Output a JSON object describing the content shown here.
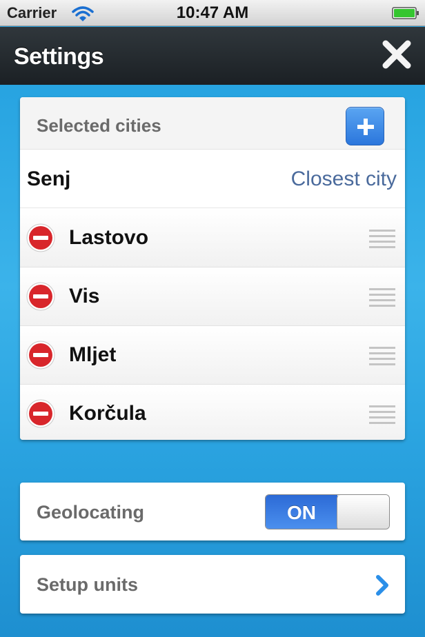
{
  "status_bar": {
    "carrier": "Carrier",
    "time": "10:47 AM",
    "icons": [
      "wifi-icon",
      "battery-icon"
    ]
  },
  "header": {
    "title": "Settings",
    "close_icon": "close-icon"
  },
  "cities": {
    "header_label": "Selected cities",
    "add_icon": "plus-icon",
    "closest": {
      "name": "Senj",
      "label": "Closest city"
    },
    "items": [
      {
        "name": "Lastovo"
      },
      {
        "name": "Vis"
      },
      {
        "name": "Mljet"
      },
      {
        "name": "Korčula"
      }
    ]
  },
  "geolocating": {
    "label": "Geolocating",
    "toggle_label": "ON",
    "toggle_state": true
  },
  "setup_units": {
    "label": "Setup units",
    "icon": "chevron-right-icon"
  },
  "colors": {
    "accent": "#2b76dc",
    "background": "#2aa3e0",
    "remove": "#d8262b",
    "closest_label": "#4a6a9c"
  }
}
